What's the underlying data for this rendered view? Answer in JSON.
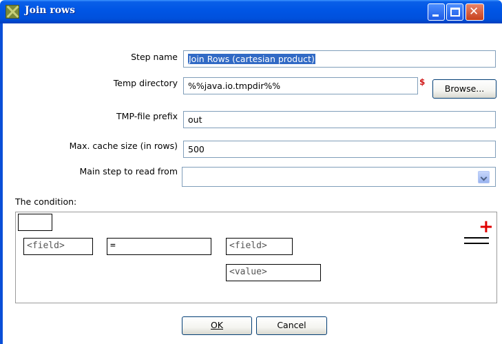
{
  "window": {
    "title": "Join rows"
  },
  "fields": {
    "step_name": {
      "label": "Step name",
      "value": "Join Rows (cartesian product)"
    },
    "temp_directory": {
      "label": "Temp directory",
      "value": "%%java.io.tmpdir%%",
      "variable_marker": "$"
    },
    "tmp_file_prefix": {
      "label": "TMP-file prefix",
      "value": "out"
    },
    "max_cache_size": {
      "label": "Max. cache size (in rows)",
      "value": "500"
    },
    "main_step": {
      "label": "Main step to read from",
      "value": ""
    }
  },
  "buttons": {
    "browse": "Browse...",
    "ok": "OK",
    "cancel": "Cancel"
  },
  "condition": {
    "label": "The condition:",
    "left_field": "<field>",
    "operator": "=",
    "right_field": "<field>",
    "right_value": "<value>",
    "add_icon": "+"
  },
  "colors": {
    "titlebar": "#0056e5",
    "selection": "#316ac5",
    "variable_marker": "#d01818",
    "add_icon": "#e00000"
  }
}
